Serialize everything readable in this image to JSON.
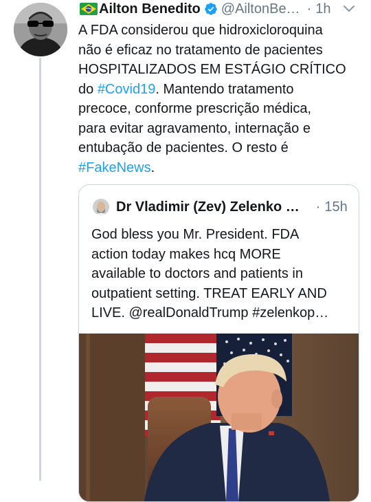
{
  "tweet": {
    "author_name": "Ailton Benedito",
    "handle": "@AiltonBe…",
    "separator": "·",
    "time": "1h",
    "text_lines": [
      "A FDA considerou que hidroxicloroquina",
      "não é eficaz no tratamento de pacientes",
      "HOSPITALIZADOS EM ESTÁGIO CRÍTICO",
      "do ",
      "#Covid19",
      ". Mantendo tratamento",
      "precoce, conforme prescrição médica,",
      "para evitar agravamento, internação e",
      "entubação de pacientes. O resto é",
      "#FakeNews",
      "."
    ]
  },
  "quoted": {
    "author_name": "Dr Vladimir (Zev) Zelenko …",
    "separator": "·",
    "time": "15h",
    "text_lines": [
      "God bless you Mr. President. FDA",
      "action today makes hcq MORE",
      "available to doctors and patients in",
      "outpatient setting. TREAT EARLY AND",
      "LIVE. @realDonaldTrump #zelenkop…"
    ]
  },
  "icons": {
    "flag": "brazil-flag-icon",
    "verified": "verified-badge-icon",
    "more": "chevron-down-icon"
  },
  "colors": {
    "link": "#1da1f2",
    "secondary": "#657786",
    "verified": "#1da1f2"
  }
}
